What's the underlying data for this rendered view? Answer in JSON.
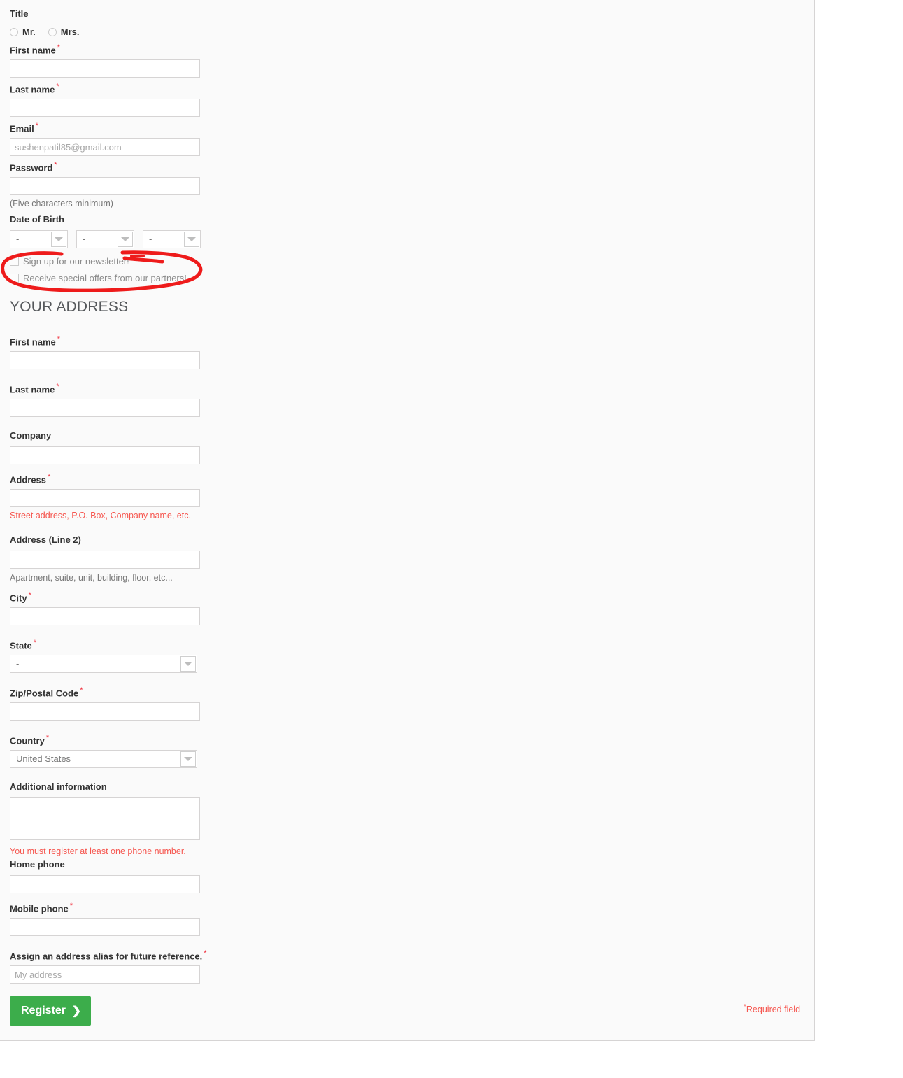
{
  "personal": {
    "title_label": "Title",
    "titles": [
      {
        "id": "mr",
        "label": "Mr."
      },
      {
        "id": "mrs",
        "label": "Mrs."
      }
    ],
    "first_name_label": "First name",
    "first_name_value": "",
    "last_name_label": "Last name",
    "last_name_value": "",
    "email_label": "Email",
    "email_placeholder": "sushenpatil85@gmail.com",
    "email_value": "",
    "password_label": "Password",
    "password_value": "",
    "password_hint": "(Five characters minimum)",
    "dob_label": "Date of Birth",
    "dob_day": "-",
    "dob_month": "-",
    "dob_year": "-",
    "newsletter_label": "Sign up for our newsletter!",
    "newsletter_checked": false,
    "partners_label": "Receive special offers from our partners!",
    "partners_checked": false
  },
  "address": {
    "section_title": "YOUR ADDRESS",
    "first_name_label": "First name",
    "first_name_value": "",
    "last_name_label": "Last name",
    "last_name_value": "",
    "company_label": "Company",
    "company_value": "",
    "address_label": "Address",
    "address_value": "",
    "address_hint": "Street address, P.O. Box, Company name, etc.",
    "address2_label": "Address (Line 2)",
    "address2_value": "",
    "address2_hint": "Apartment, suite, unit, building, floor, etc...",
    "city_label": "City",
    "city_value": "",
    "state_label": "State",
    "state_value": "-",
    "zip_label": "Zip/Postal Code",
    "zip_value": "",
    "country_label": "Country",
    "country_value": "United States",
    "additional_label": "Additional information",
    "additional_value": "",
    "phone_warning": "You must register at least one phone number.",
    "home_phone_label": "Home phone",
    "home_phone_value": "",
    "mobile_phone_label": "Mobile phone",
    "mobile_phone_value": "",
    "alias_label": "Assign an address alias for future reference.",
    "alias_placeholder": "My address",
    "alias_value": ""
  },
  "footer": {
    "register_label": "Register",
    "register_chevron": "❯",
    "required_star": "*",
    "required_text": "Required field"
  },
  "annotation": {
    "type": "hand-drawn-ellipse",
    "color": "#ee1b1b",
    "targets": [
      "newsletter-checkbox",
      "partners-checkbox"
    ]
  },
  "colors": {
    "panel_background": "#fafafa",
    "page_background": "#ffffff",
    "input_border": "#d6d4d4",
    "label_text": "#333333",
    "hint_text": "#777777",
    "required_red": "#f13340",
    "warning_red": "#f6564f",
    "register_green": "#3cad4b",
    "annotation_red": "#ee1b1b",
    "heading_text": "#55585b"
  }
}
